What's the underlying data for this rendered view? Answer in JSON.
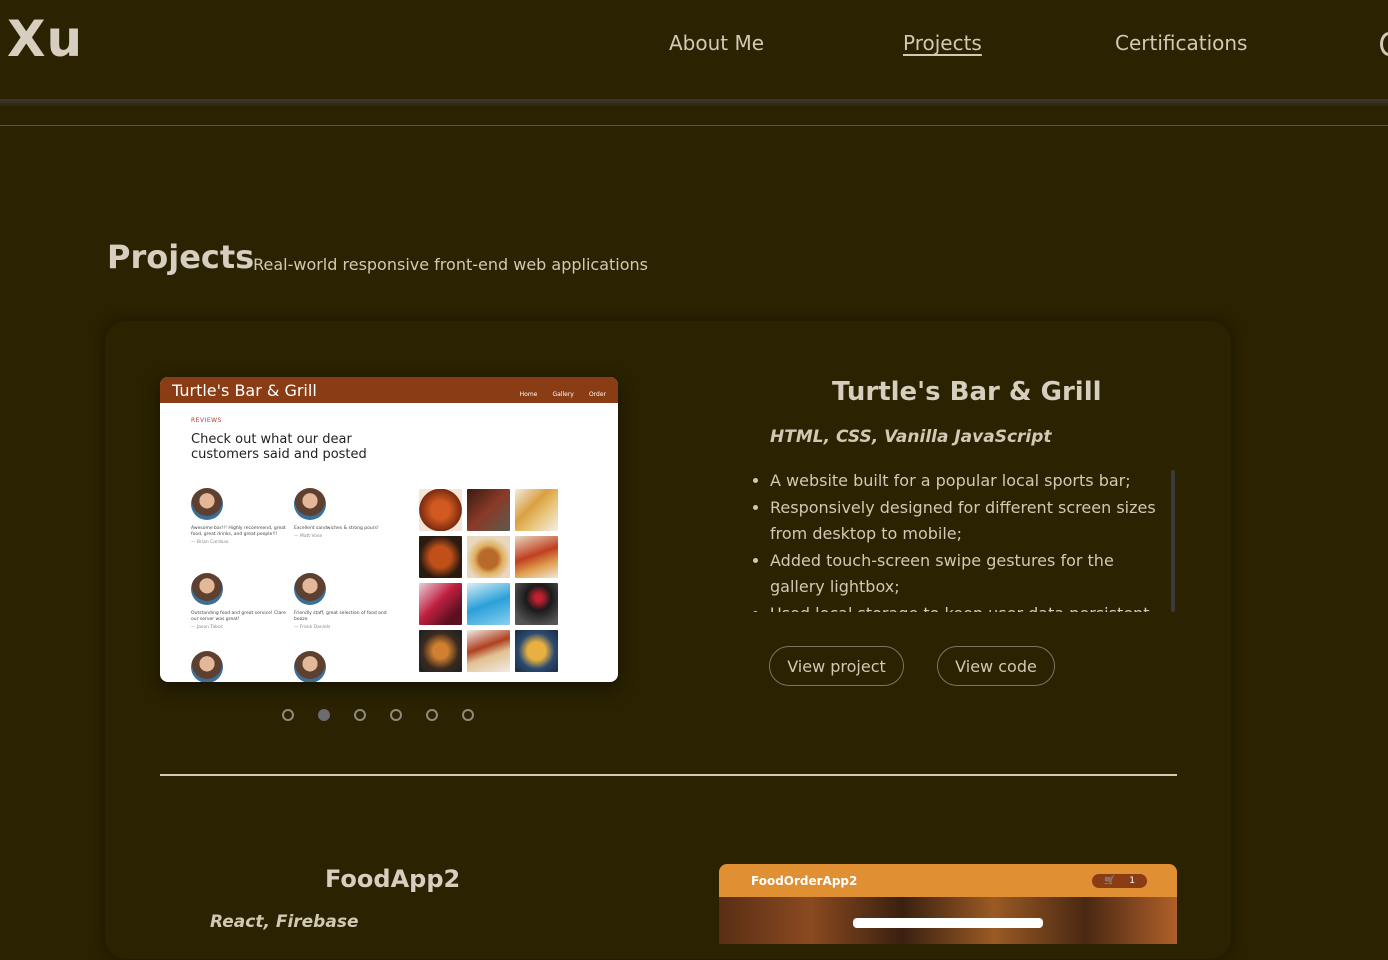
{
  "header": {
    "logo": "Xu",
    "nav": [
      {
        "label": "About Me",
        "active": false
      },
      {
        "label": "Projects",
        "active": true
      },
      {
        "label": "Certifications",
        "active": false
      }
    ]
  },
  "section": {
    "title": "Projects",
    "subtitle": "– Real-world responsive front-end web applications"
  },
  "project1": {
    "preview": {
      "site_title": "Turtle's Bar & Grill",
      "links": [
        "Home",
        "Gallery",
        "Order"
      ],
      "label": "REVIEWS",
      "heading": "Check out what our dear customers said and posted",
      "reviews": [
        {
          "text": "Awesome bar!!! Highly recommend, great food, great drinks, and great people!!!",
          "who": "— Brian Cardoso"
        },
        {
          "text": "Excellent sandwiches & strong pours!",
          "who": "— Matt Vose"
        },
        {
          "text": "Outstanding food and great service! Clare our server was great!",
          "who": "— Jason Tabor"
        },
        {
          "text": "Friendly staff, great selection of food and booze",
          "who": "— Frank Daniels"
        }
      ]
    },
    "carousel": {
      "count": 6,
      "active_index": 1
    },
    "title": "Turtle's Bar & Grill",
    "tech": "HTML, CSS, Vanilla JavaScript",
    "bullets": [
      "A website built for a popular local sports bar;",
      "Responsively designed for different screen sizes from desktop to mobile;",
      "Added touch-screen swipe gestures for the gallery lightbox;",
      "Used local storage to keep user data persistent"
    ],
    "buttons": {
      "view_project": "View project",
      "view_code": "View code"
    }
  },
  "project2": {
    "title": "FoodApp2",
    "tech": "React, Firebase",
    "preview": {
      "site_title": "FoodOrderApp2",
      "cart_count": "1"
    }
  },
  "colors": {
    "background": "#2a2200",
    "text": "#d0c9b5",
    "preview_header": "#8a3c14",
    "preview2_header": "#e08f33"
  }
}
